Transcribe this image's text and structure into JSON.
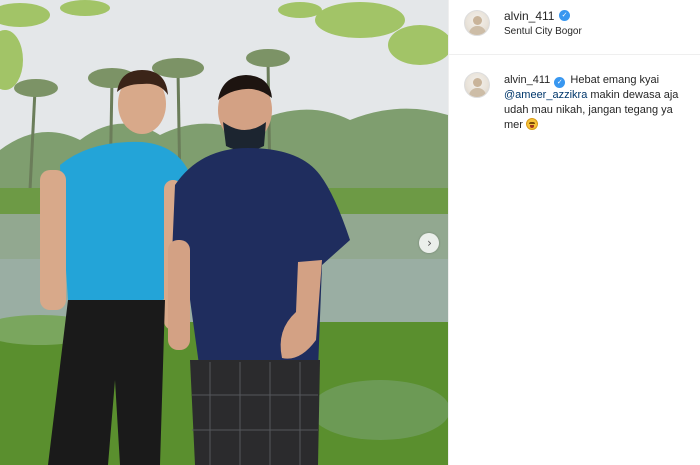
{
  "post": {
    "username": "alvin_411",
    "location": "Sentul City Bogor",
    "verified_icon": "verified-badge-icon",
    "carousel_next_glyph": "›"
  },
  "caption": {
    "username": "alvin_411",
    "text_before": "Hebat emang kyai ",
    "mention": "@ameer_azzikra",
    "text_after": " makin dewasa aja udah mau nikah, jangan tegang ya mer",
    "emoji_icon": "grinning-sweat-emoji-icon"
  },
  "colors": {
    "verified": "#3897f0",
    "mention": "#00376b",
    "divider": "#efefef"
  }
}
